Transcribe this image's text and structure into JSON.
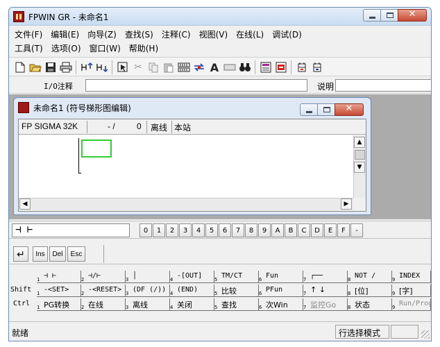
{
  "window": {
    "title": "FPWIN GR - 未命名1"
  },
  "menu": {
    "row1": [
      "文件(F)",
      "编辑(E)",
      "向导(Z)",
      "查找(S)",
      "注释(C)",
      "视图(V)",
      "在线(L)",
      "调试(D)"
    ],
    "row2": [
      "工具(T)",
      "选项(O)",
      "窗口(W)",
      "帮助(H)"
    ]
  },
  "toolbar": {
    "icons": [
      "new-file-icon",
      "open-folder-icon",
      "save-icon",
      "print-icon",
      "ladder-up-icon",
      "ladder-down-icon",
      "cursor-tool-icon",
      "cut-icon",
      "copy-icon",
      "paste-icon",
      "switch-icon",
      "transfer-icon",
      "text-a-icon",
      "block-icon",
      "binoculars-icon",
      "monitor-icon",
      "reg-icon",
      "plc-icon",
      "plc2-icon"
    ],
    "text_a": "A"
  },
  "io": {
    "label": "I/O注释",
    "desc_label": "说明"
  },
  "child": {
    "title": "未命名1 (符号梯形图编辑)",
    "plc": "FP SIGMA 32K",
    "slash": "- /",
    "step": "0",
    "offline": "离线",
    "station": "本站"
  },
  "func_row": {
    "contact": "⊣ ⊢",
    "keys": [
      "0",
      "1",
      "2",
      "3",
      "4",
      "5",
      "6",
      "7",
      "8",
      "9",
      "A",
      "B",
      "C",
      "D",
      "E",
      "F",
      "-"
    ]
  },
  "edit_keys": {
    "enter": "↵",
    "ins": "Ins",
    "del": "Del",
    "esc": "Esc"
  },
  "fkeys": {
    "shift_label": "Shift",
    "ctrl_label": "Ctrl",
    "row_a": [
      {
        "n": "1",
        "t": "⊣ ⊢"
      },
      {
        "n": "2",
        "t": "⊣/⊢"
      },
      {
        "n": "3",
        "t": "│"
      },
      {
        "n": "4",
        "t": "-[OUT]"
      },
      {
        "n": "5",
        "t": "TM/CT"
      },
      {
        "n": "6",
        "t": "Fun"
      },
      {
        "n": "7",
        "t": "┌──"
      },
      {
        "n": "8",
        "t": "NOT /"
      },
      {
        "n": "9",
        "t": "INDEX"
      }
    ],
    "row_b": [
      {
        "n": "1",
        "t": "-<SET>"
      },
      {
        "n": "2",
        "t": "-<RESET>"
      },
      {
        "n": "3",
        "t": "(DF (/))"
      },
      {
        "n": "4",
        "t": "(END)"
      },
      {
        "n": "5",
        "t": "比较"
      },
      {
        "n": "6",
        "t": "PFun"
      },
      {
        "n": "7",
        "t": "↑ ↓"
      },
      {
        "n": "8",
        "t": "[位]"
      },
      {
        "n": "9",
        "t": "[字]"
      }
    ],
    "row_c": [
      {
        "n": "1",
        "t": "PG转换"
      },
      {
        "n": "2",
        "t": "在线"
      },
      {
        "n": "3",
        "t": "离线"
      },
      {
        "n": "4",
        "t": "关闭"
      },
      {
        "n": "5",
        "t": "查找"
      },
      {
        "n": "6",
        "t": "次Win"
      },
      {
        "n": "7",
        "t": "监控Go"
      },
      {
        "n": "8",
        "t": "状态"
      },
      {
        "n": "9",
        "t": "Run/Prog"
      }
    ]
  },
  "status": {
    "text": "就绪",
    "mode": "行选择模式"
  }
}
